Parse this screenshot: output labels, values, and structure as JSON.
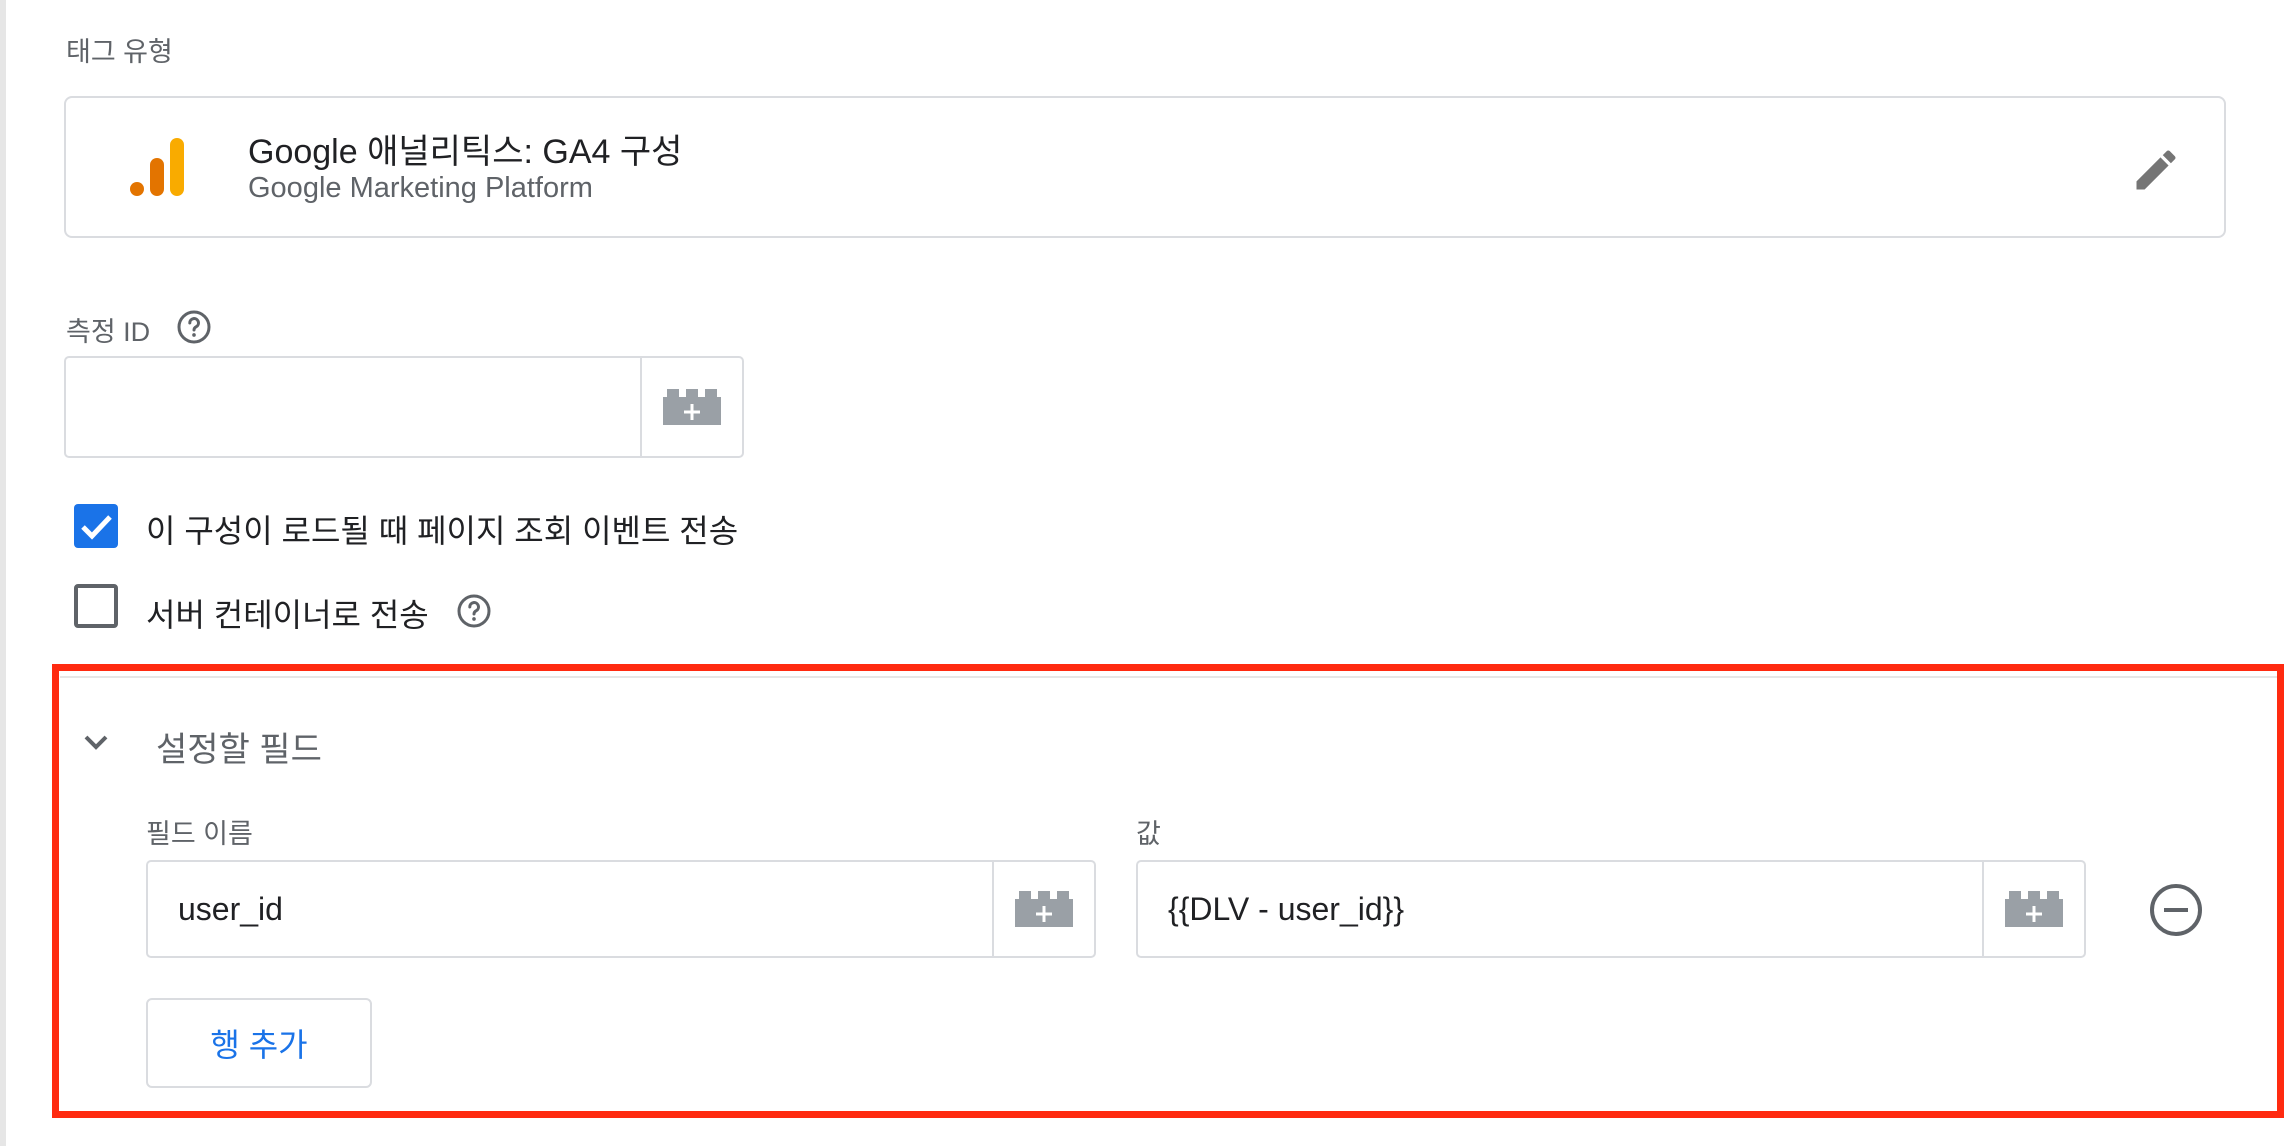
{
  "tag_type": {
    "section_label": "태그 유형",
    "title": "Google 애널리틱스: GA4 구성",
    "subtitle": "Google Marketing Platform",
    "icon": "google-analytics-icon",
    "edit_icon": "pencil-icon"
  },
  "measurement_id": {
    "label": "측정 ID",
    "value": "",
    "help_icon": "help-circle-icon",
    "picker_icon": "variable-block-icon"
  },
  "options": [
    {
      "label": "이 구성이 로드될 때 페이지 조회 이벤트 전송",
      "checked": true
    },
    {
      "label": "서버 컨테이너로 전송",
      "checked": false
    }
  ],
  "fields_to_set": {
    "title": "설정할 필드",
    "field_name_header": "필드 이름",
    "value_header": "값",
    "rows": [
      {
        "field_name": "user_id",
        "value": "{{DLV - user_id}}"
      }
    ],
    "add_row_label": "행 추가"
  },
  "colors": {
    "accent": "#1a73e8",
    "highlight": "#ff2a10",
    "ga_orange": "#f9ab00",
    "ga_dark_orange": "#e37400"
  }
}
